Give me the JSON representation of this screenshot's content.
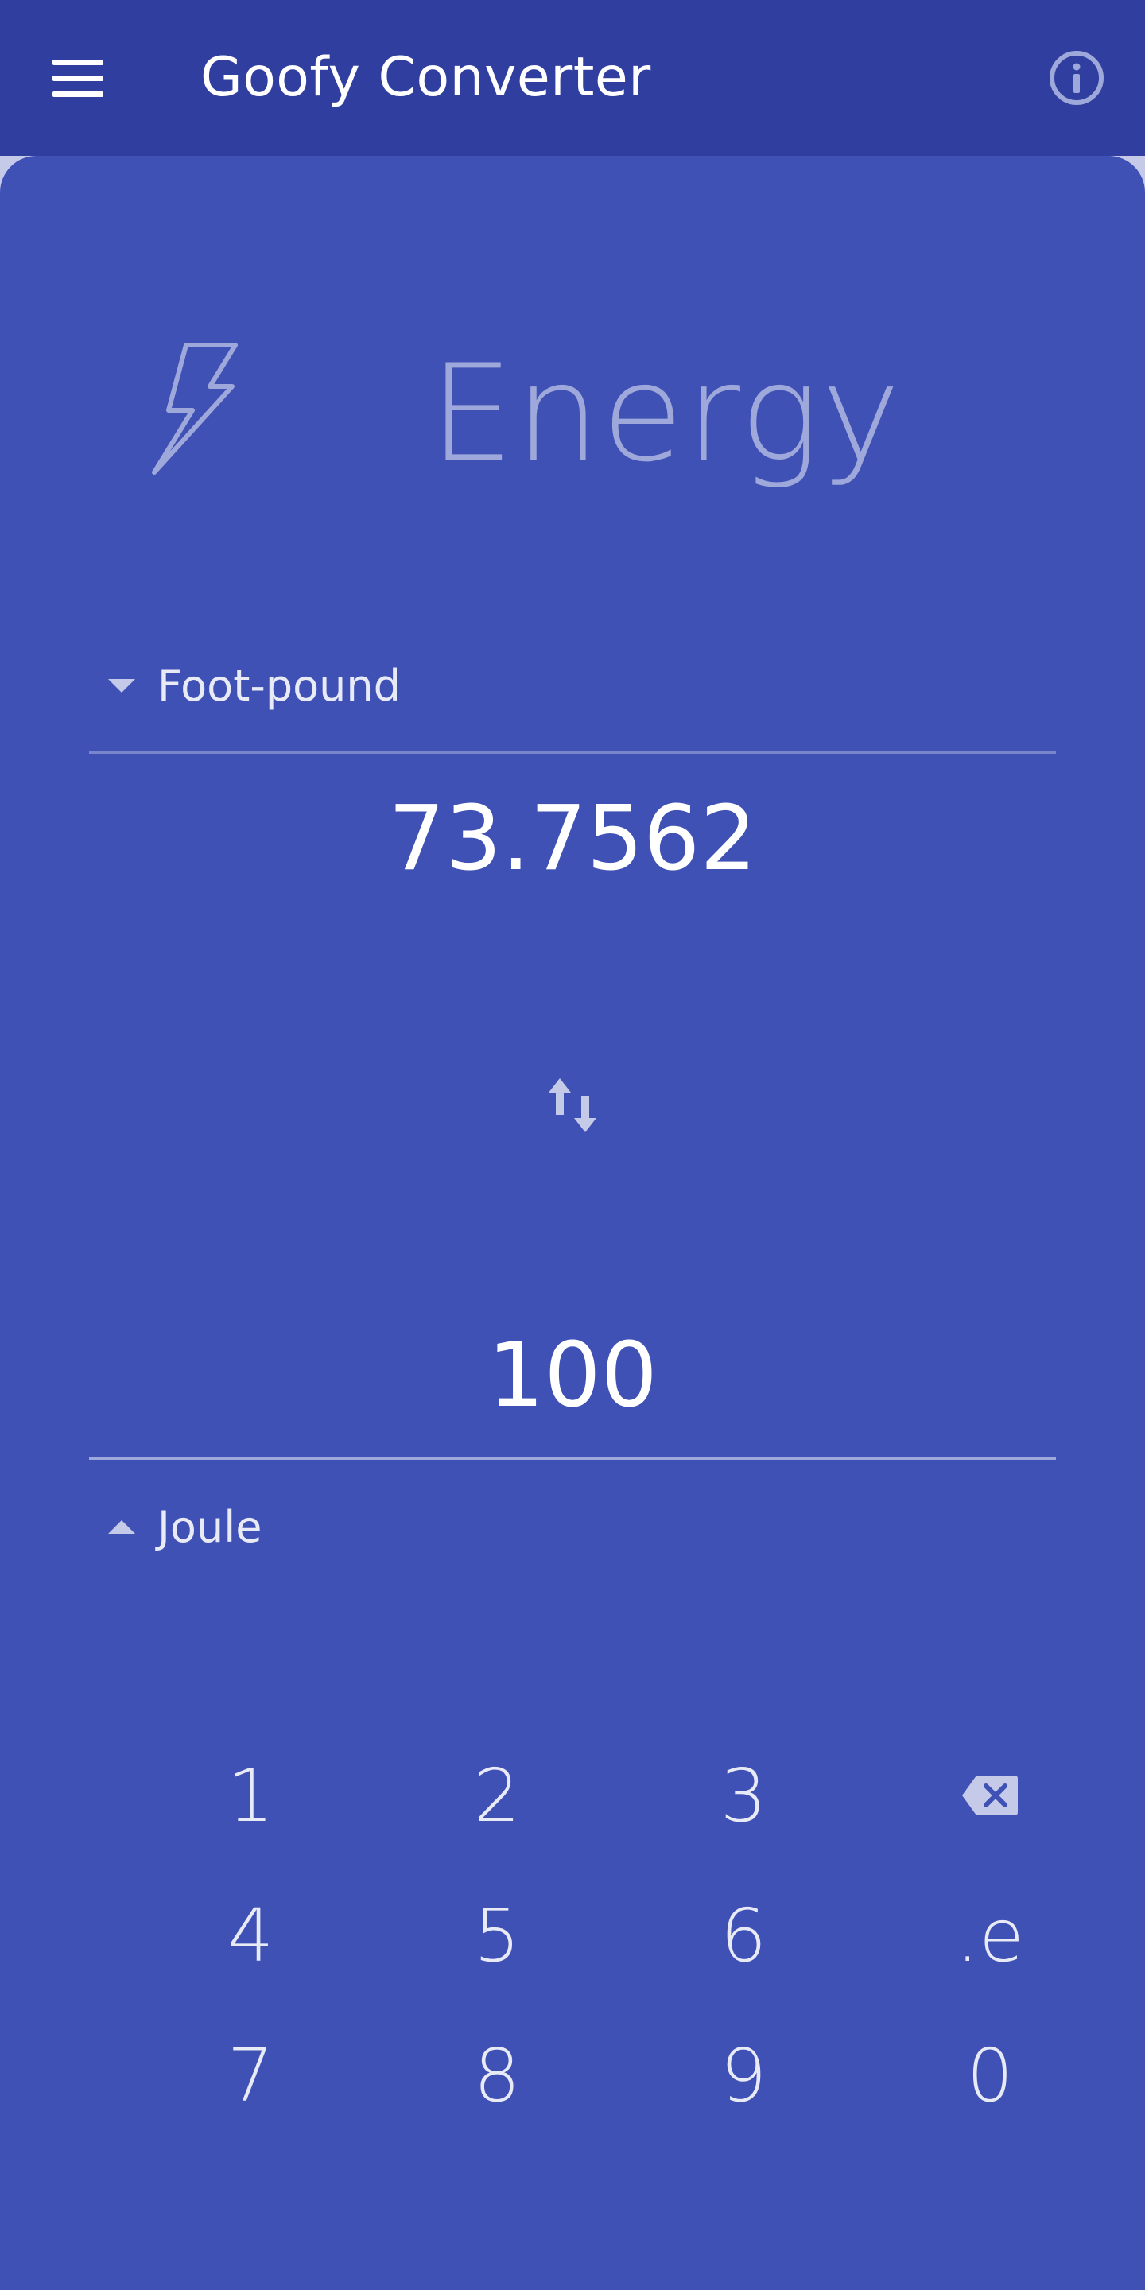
{
  "app": {
    "title": "Goofy Converter"
  },
  "colors": {
    "appbar": "#303f9f",
    "background": "#3f51b5",
    "accent_light": "#9fa8da",
    "text": "#ffffff"
  },
  "icons": {
    "menu": "menu-icon",
    "info": "info-icon",
    "category": "lightning-bolt-icon",
    "swap": "swap-vertical-icon",
    "backspace": "backspace-icon"
  },
  "category": {
    "name": "Energy"
  },
  "top_converter": {
    "unit": "Foot-pound",
    "value": "73.7562"
  },
  "bottom_converter": {
    "unit": "Joule",
    "value": "100"
  },
  "keypad": {
    "keys": [
      "1",
      "2",
      "3",
      "⌫",
      "4",
      "5",
      "6",
      ".e",
      "7",
      "8",
      "9",
      "0"
    ]
  }
}
